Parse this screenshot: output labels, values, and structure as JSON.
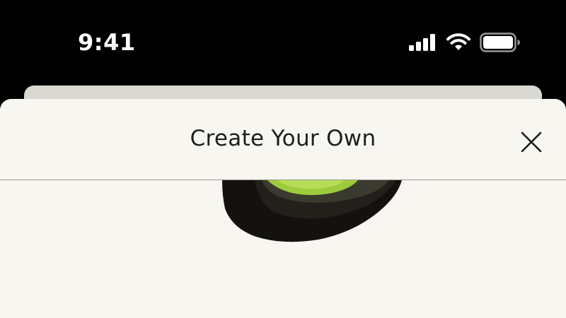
{
  "status_bar": {
    "time": "9:41",
    "icons": [
      "cellular-signal-icon",
      "wifi-icon",
      "battery-icon"
    ]
  },
  "sheet": {
    "title": "Create Your Own",
    "close_icon": "close-icon",
    "hero_image": "avocado-image"
  },
  "colors": {
    "background": "#000000",
    "sheet": "#f8f6f0",
    "back_card": "#d9d8d3",
    "title_text": "#1e1e1c",
    "divider": "#9a9a96"
  }
}
